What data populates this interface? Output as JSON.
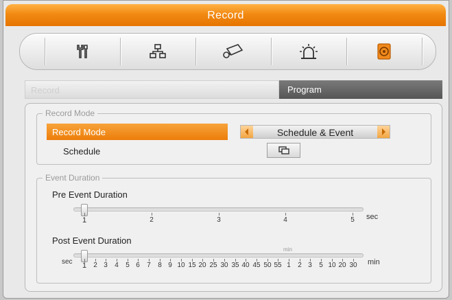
{
  "window": {
    "title": "Record"
  },
  "toolbar": {
    "items": [
      {
        "name": "setup",
        "icon": "tools-icon"
      },
      {
        "name": "network",
        "icon": "network-icon"
      },
      {
        "name": "camera",
        "icon": "camera-icon"
      },
      {
        "name": "alarm",
        "icon": "alarm-light-icon"
      },
      {
        "name": "record",
        "icon": "record-disk-icon",
        "active": true
      }
    ]
  },
  "tabs": {
    "record_label": "Record",
    "program_label": "Program"
  },
  "record_mode": {
    "legend": "Record Mode",
    "label": "Record Mode",
    "value": "Schedule & Event",
    "schedule_label": "Schedule"
  },
  "event_duration": {
    "legend": "Event Duration",
    "pre": {
      "label": "Pre Event Duration",
      "ticks": [
        "1",
        "2",
        "3",
        "4",
        "5"
      ],
      "unit": "sec",
      "value": "1"
    },
    "post": {
      "label": "Post Event Duration",
      "left_unit": "sec",
      "right_unit": "min",
      "mid_unit": "min",
      "ticks": [
        "1",
        "2",
        "3",
        "4",
        "5",
        "6",
        "7",
        "8",
        "9",
        "10",
        "15",
        "20",
        "25",
        "30",
        "35",
        "40",
        "45",
        "50",
        "55",
        "1",
        "2",
        "3",
        "5",
        "10",
        "20",
        "30"
      ],
      "value": "1"
    }
  },
  "colors": {
    "accent": "#f28a12",
    "tab_active": "#5e5e5e"
  }
}
